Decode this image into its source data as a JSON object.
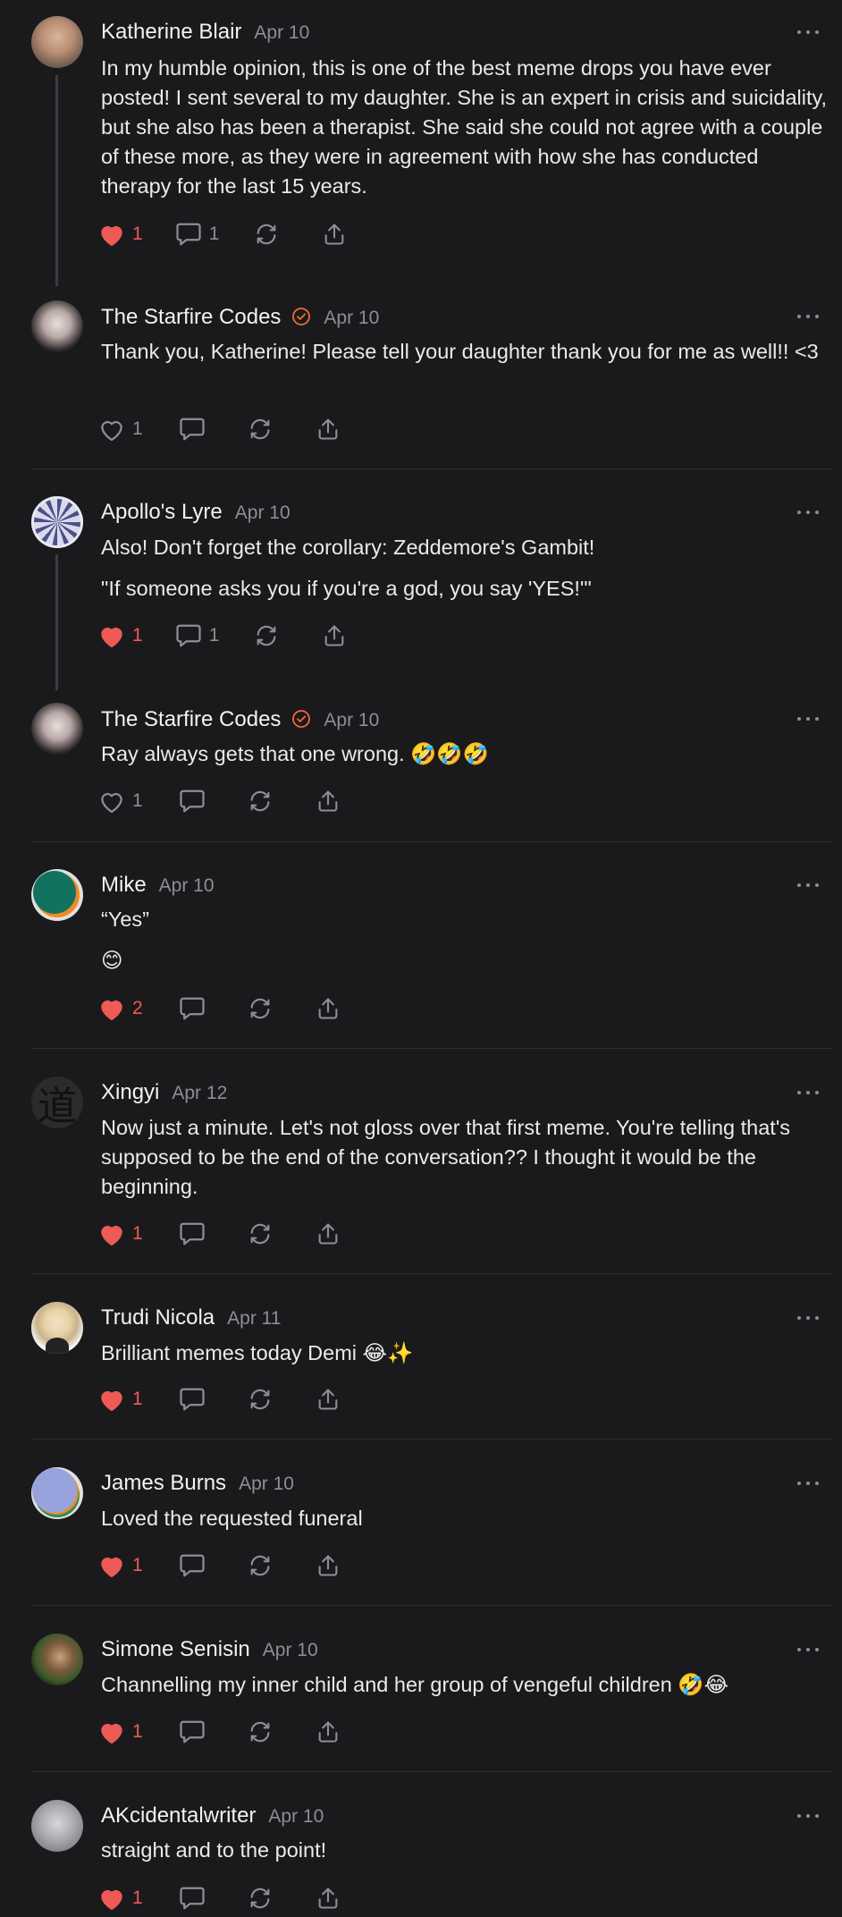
{
  "colors": {
    "background": "#1a1a1c",
    "liked": "#ee5a55",
    "muted": "#8e8e93",
    "verified": "#f06a35"
  },
  "comments": [
    {
      "author": "Katherine Blair",
      "date": "Apr 10",
      "verified": false,
      "paragraphs": [
        "In my humble opinion, this is one of the best meme drops you have ever posted! I sent several to my daughter. She is an expert in crisis and suicidality, but she also has been a therapist. She said she could not agree with a couple of these more, as they were in agreement with how she has conducted therapy for the last 15 years."
      ],
      "likes": "1",
      "liked": true,
      "replies": "1"
    },
    {
      "author": "The Starfire Codes",
      "date": "Apr 10",
      "verified": true,
      "paragraphs": [
        "Thank you, Katherine! Please tell your daughter thank you for me as well!! <3"
      ],
      "likes": "1",
      "liked": false,
      "replies": ""
    },
    {
      "author": "Apollo's Lyre",
      "date": "Apr 10",
      "verified": false,
      "paragraphs": [
        "Also! Don't forget the corollary: Zeddemore's Gambit!",
        "\"If someone asks you if you're a god, you say 'YES!'\""
      ],
      "likes": "1",
      "liked": true,
      "replies": "1"
    },
    {
      "author": "The Starfire Codes",
      "date": "Apr 10",
      "verified": true,
      "paragraphs": [
        "Ray always gets that one wrong. 🤣🤣🤣"
      ],
      "likes": "1",
      "liked": false,
      "replies": ""
    },
    {
      "author": "Mike",
      "date": "Apr 10",
      "verified": false,
      "paragraphs": [
        "“Yes”",
        "😊"
      ],
      "likes": "2",
      "liked": true,
      "replies": ""
    },
    {
      "author": "Xingyi",
      "date": "Apr 12",
      "verified": false,
      "paragraphs": [
        "Now just a minute. Let's not gloss over that first meme. You're telling that's supposed to be the end of the conversation?? I thought it would be the beginning."
      ],
      "likes": "1",
      "liked": true,
      "replies": ""
    },
    {
      "author": "Trudi Nicola",
      "date": "Apr 11",
      "verified": false,
      "paragraphs": [
        "Brilliant memes today Demi 😂✨"
      ],
      "likes": "1",
      "liked": true,
      "replies": ""
    },
    {
      "author": "James Burns",
      "date": "Apr 10",
      "verified": false,
      "paragraphs": [
        "Loved the requested funeral"
      ],
      "likes": "1",
      "liked": true,
      "replies": ""
    },
    {
      "author": "Simone Senisin",
      "date": "Apr 10",
      "verified": false,
      "paragraphs": [
        "Channelling my inner child and her group of vengeful children 🤣😂"
      ],
      "likes": "1",
      "liked": true,
      "replies": ""
    },
    {
      "author": "AKcidentalwriter",
      "date": "Apr 10",
      "verified": false,
      "paragraphs": [
        "straight and to the point!"
      ],
      "likes": "1",
      "liked": true,
      "replies": ""
    }
  ]
}
